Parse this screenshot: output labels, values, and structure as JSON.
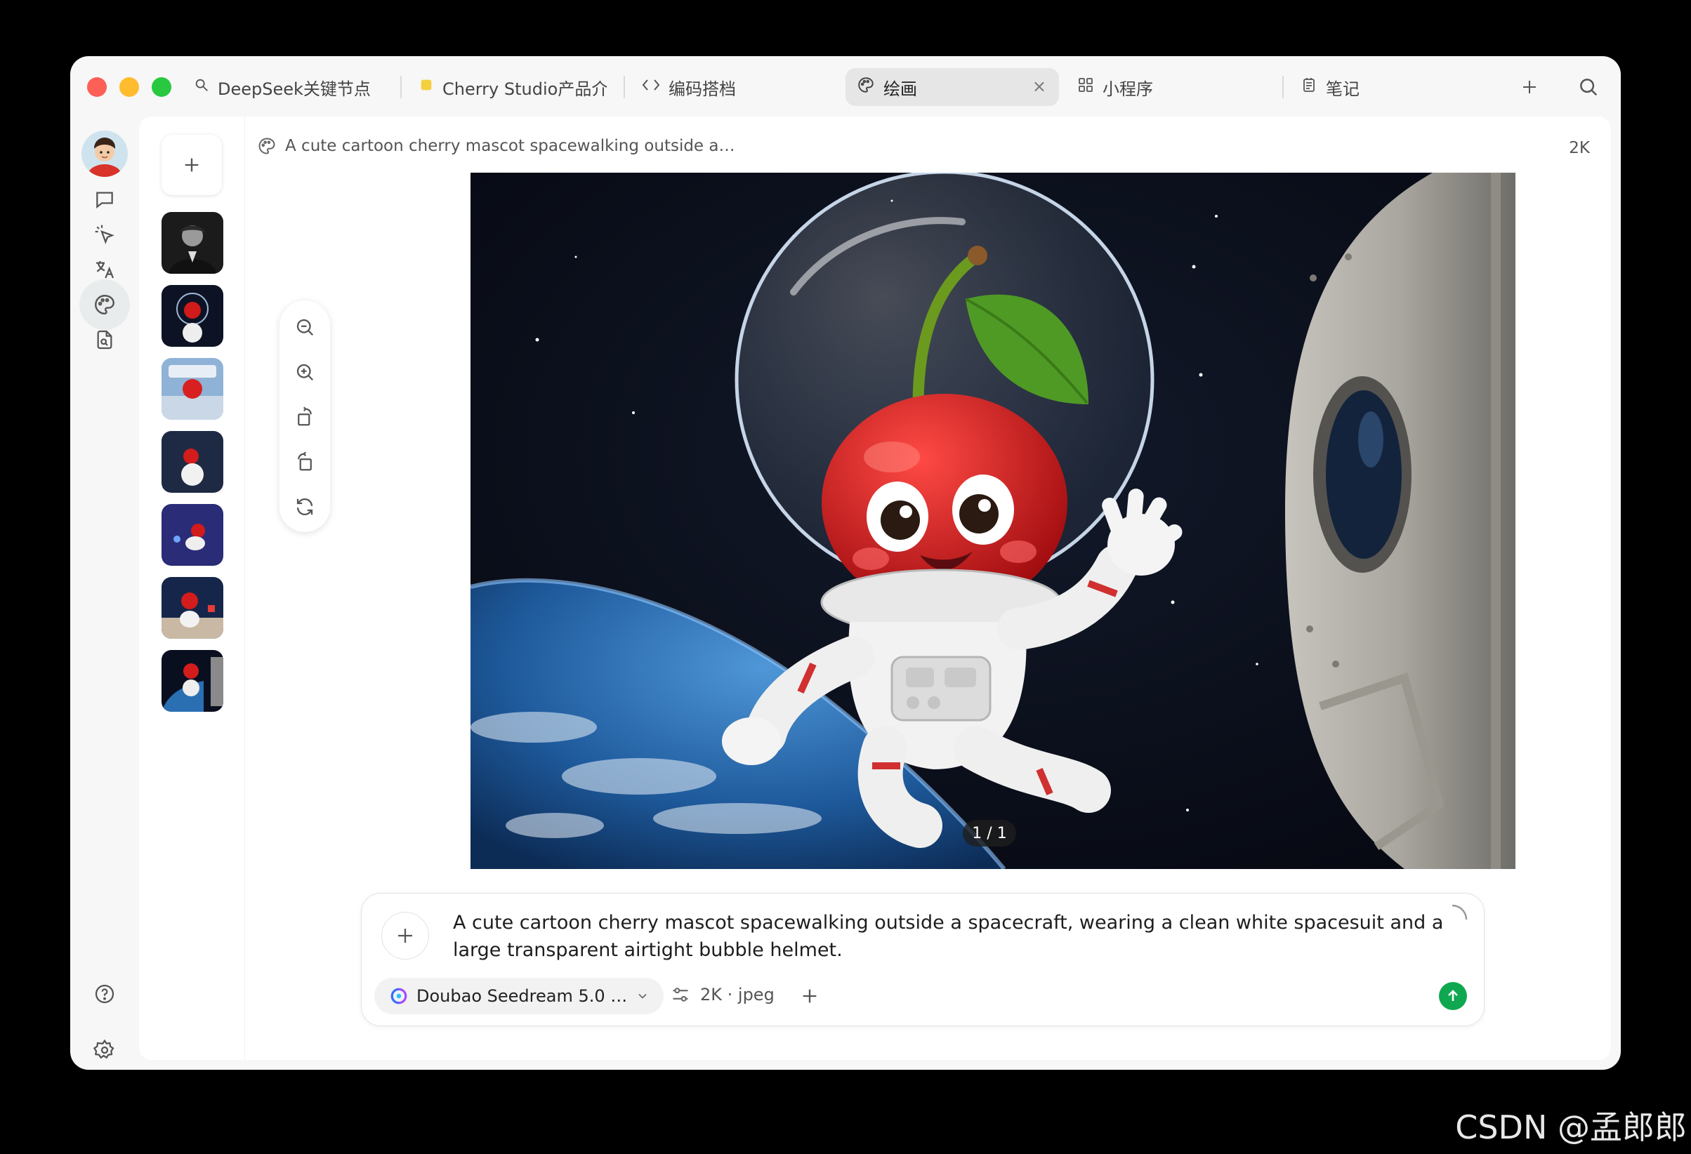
{
  "tabs": [
    {
      "label": "DeepSeek关键节点",
      "icon": "search-icon"
    },
    {
      "label": "Cherry Studio产品介",
      "icon": "note-icon"
    },
    {
      "label": "编码搭档",
      "icon": "code-icon"
    },
    {
      "label": "绘画",
      "icon": "palette-icon",
      "active": true
    },
    {
      "label": "小程序",
      "icon": "grid-icon"
    },
    {
      "label": "笔记",
      "icon": "notebook-icon"
    }
  ],
  "header": {
    "title": "A cute cartoon cherry mascot spacewalking outside a…",
    "size": "2K"
  },
  "image": {
    "counter": "1 / 1"
  },
  "composer": {
    "prompt": "A cute cartoon cherry mascot spacewalking outside a spacecraft, wearing a clean white spacesuit and a large transparent airtight bubble helmet.",
    "model": "Doubao Seedream 5.0 …",
    "options": "2K · jpeg"
  },
  "watermark": "CSDN @孟郎郎",
  "colors": {
    "send": "#10a751",
    "traffic_red": "#fe5f57",
    "traffic_yellow": "#febc2e",
    "traffic_green": "#28c840"
  }
}
